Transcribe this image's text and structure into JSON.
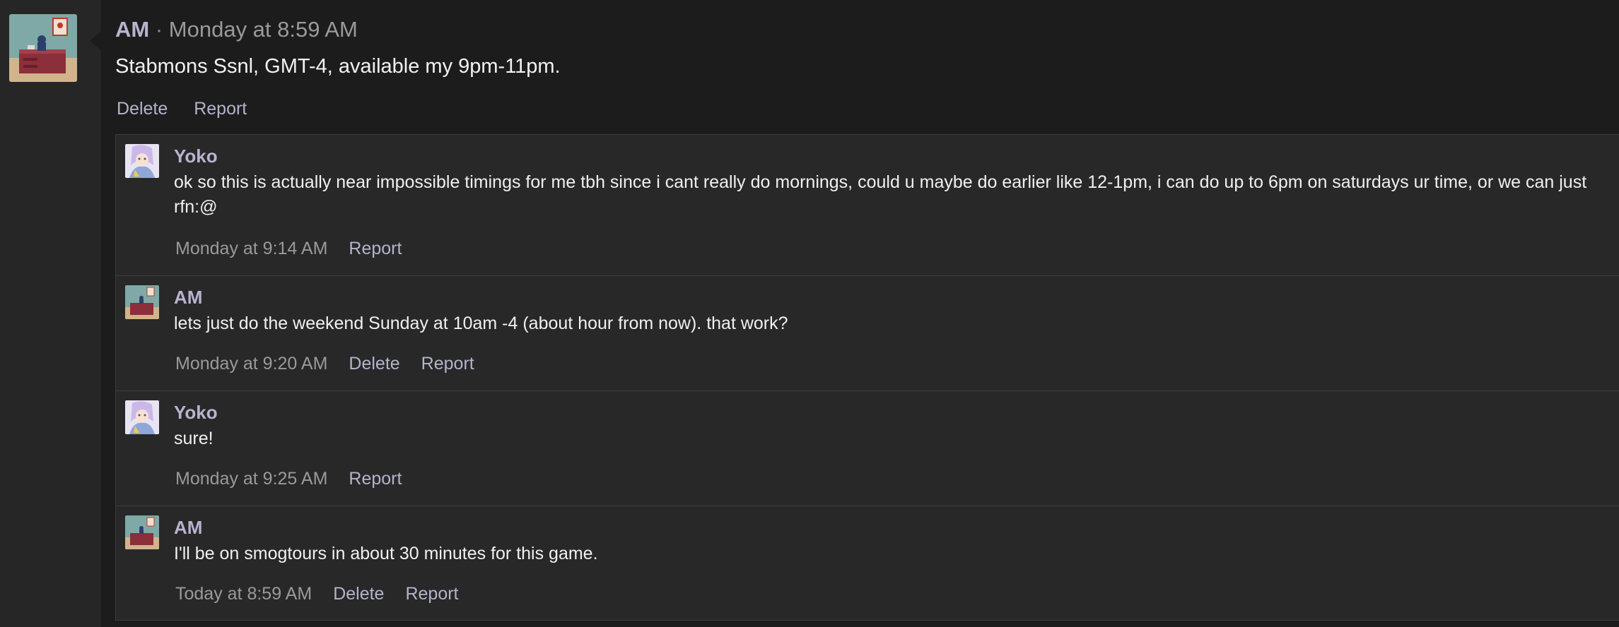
{
  "post": {
    "author": "AM",
    "separator": " · ",
    "time": "Monday at 8:59 AM",
    "body": "Stabmons Ssnl, GMT-4, available my 9pm-11pm.",
    "actions": [
      "Delete",
      "Report"
    ]
  },
  "replies": [
    {
      "author": "Yoko",
      "body": "ok so this is actually near impossible timings for me tbh since i cant really do mornings, could u maybe do earlier like 12-1pm, i can do up to 6pm on saturdays ur time, or we can just rfn:@",
      "time": "Monday at 9:14 AM",
      "actions": [
        "Report"
      ]
    },
    {
      "author": "AM",
      "body": "lets just do the weekend Sunday at 10am -4 (about hour from now). that work?",
      "time": "Monday at 9:20 AM",
      "actions": [
        "Delete",
        "Report"
      ]
    },
    {
      "author": "Yoko",
      "body": "sure!",
      "time": "Monday at 9:25 AM",
      "actions": [
        "Report"
      ]
    },
    {
      "author": "AM",
      "body": "I'll be on smogtours in about 30 minutes for this game.",
      "time": "Today at 8:59 AM",
      "actions": [
        "Delete",
        "Report"
      ]
    }
  ]
}
